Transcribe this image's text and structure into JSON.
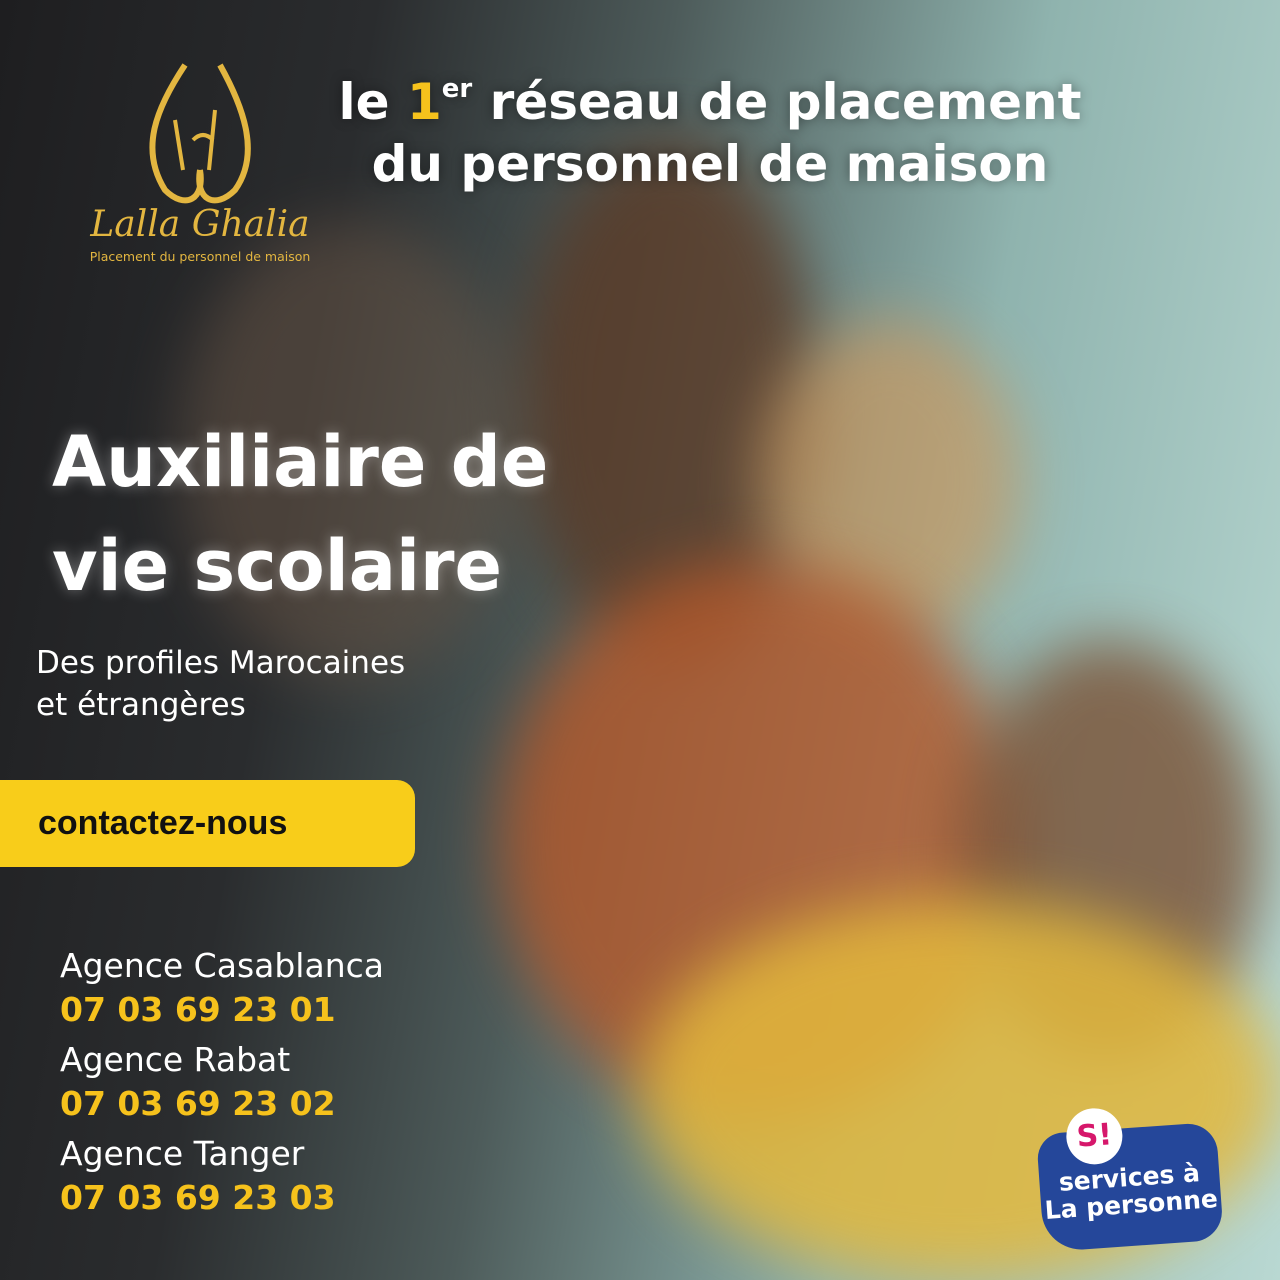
{
  "logo": {
    "brand": "Lalla Ghalia",
    "tagline": "Placement du personnel de maison"
  },
  "headline": {
    "line1_pre": "le ",
    "line1_num": "1",
    "line1_sup": "er",
    "line1_post": " réseau de placement",
    "line2": "du personnel de maison"
  },
  "title": {
    "line1": "Auxiliaire de",
    "line2": "vie scolaire"
  },
  "subtitle": {
    "line1": "Des profiles Marocaines",
    "line2": "et étrangères"
  },
  "cta": {
    "label": "contactez-nous"
  },
  "agencies": [
    {
      "name": "Agence Casablanca",
      "phone": "07 03 69 23 01"
    },
    {
      "name": "Agence Rabat",
      "phone": "07 03 69 23 02"
    },
    {
      "name": "Agence Tanger",
      "phone": "07 03 69 23 03"
    }
  ],
  "badge": {
    "mark": "S!",
    "line1": "services à",
    "line2": "La personne"
  },
  "colors": {
    "accent": "#f8cd1a",
    "gold": "#e3b640",
    "badge": "#25479a",
    "badge_mark": "#d6176b"
  }
}
